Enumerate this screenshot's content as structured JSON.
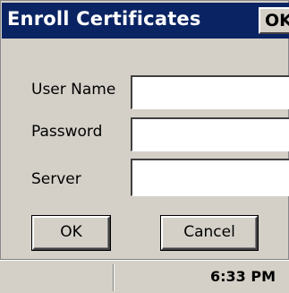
{
  "window": {
    "title": "Enroll Certificates",
    "title_ok_label": "OK"
  },
  "form": {
    "username_label": "User Name",
    "username_value": "",
    "password_label": "Password",
    "password_value": "",
    "server_label": "Server",
    "server_value": ""
  },
  "buttons": {
    "ok_label": "OK",
    "cancel_label": "Cancel"
  },
  "taskbar": {
    "clock": "6:33 PM"
  },
  "colors": {
    "titlebar": "#0a2463",
    "dialog_bg": "#d4d0c8"
  }
}
